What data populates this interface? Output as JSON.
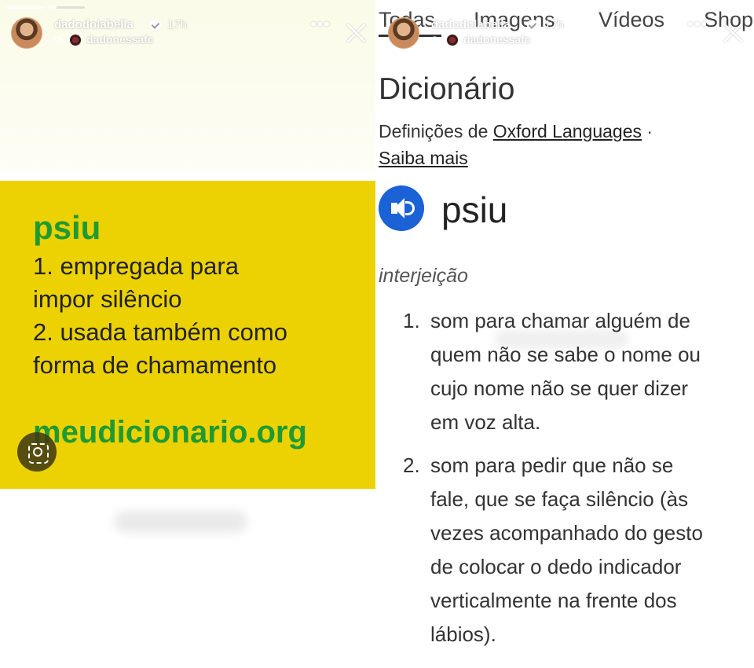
{
  "left_story": {
    "username": "dadodolabella",
    "time": "17h",
    "reposted_from": "dadonessafc",
    "more_label": "•••",
    "progress": [
      1.0,
      0.25,
      0.0
    ],
    "card": {
      "word": "psiu",
      "def1_line1": "1. empregada para",
      "def1_line2": "impor silêncio",
      "def2_line1": "2. usada também como",
      "def2_line2": "forma de chamamento",
      "site": "meudicionario.org"
    },
    "colors": {
      "card_bg": "#ecd203",
      "word_green": "#1f9a32"
    }
  },
  "right_story": {
    "username": "dadodolabella",
    "time": "17h",
    "reposted_from": "dadonessafc",
    "more_label": "•••",
    "tabs": [
      "Todas",
      "Imagens",
      "Vídeos",
      "Shop"
    ],
    "dictionary": {
      "title": "Dicionário",
      "source_prefix": "Definições de",
      "source_link": "Oxford Languages",
      "source_sep": "·",
      "learn_more": "Saiba mais",
      "word": "psiu",
      "part_of_speech": "interjeição",
      "senses": [
        {
          "num": "1.",
          "lines": [
            "som para chamar alguém de",
            "quem não se sabe o nome ou",
            "cujo nome não se quer dizer",
            "em voz alta."
          ]
        },
        {
          "num": "2.",
          "lines": [
            "som para pedir que não se",
            "fale, que se faça silêncio (às",
            "vezes acompanhado do gesto",
            "de colocar o dedo indicador",
            "verticalmente na frente dos",
            "lábios)."
          ]
        }
      ]
    },
    "colors": {
      "speaker_blue": "#1a62d6"
    }
  }
}
